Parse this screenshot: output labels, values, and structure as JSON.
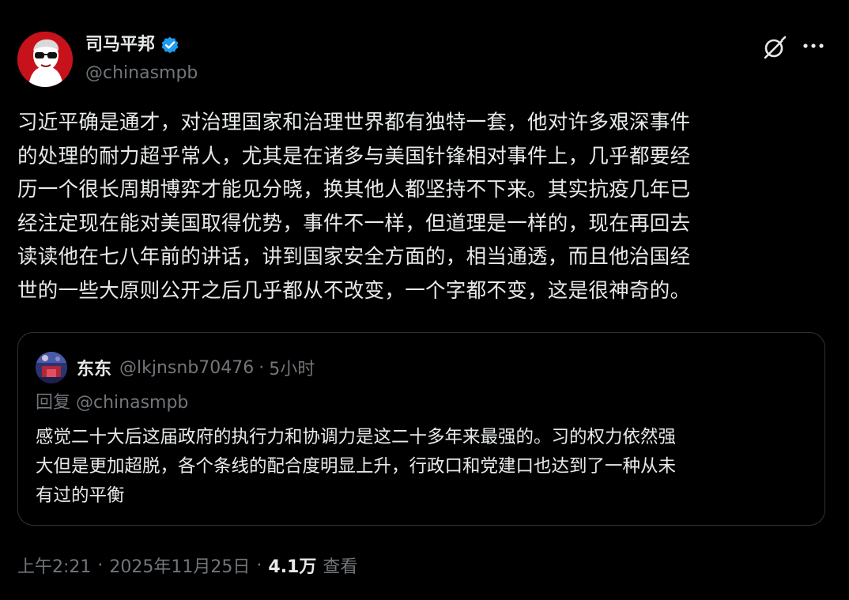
{
  "tweet": {
    "author": {
      "display_name": "司马平邦",
      "handle": "@chinasmpb",
      "verified": true,
      "badge_color": "#1d9bf0"
    },
    "text_lines": [
      "习近平确是通才，对治理国家和治理世界都有独特一套，他对许多艰深事件",
      "的处理的耐力超乎常人，尤其是在诸多与美国针锋相对事件上，几乎都要经",
      "历一个很长周期博弈才能见分晓，换其他人都坚持不下来。其实抗疫几年已",
      "经注定现在能对美国取得优势，事件不一样，但道理是一样的，现在再回去",
      "读读他在七八年前的讲话，讲到国家安全方面的，相当通透，而且他治国经",
      "世的一些大原则公开之后几乎都从不改变，一个字都不变，这是很神奇的。"
    ],
    "quote": {
      "display_name": "东东",
      "handle": "@lkjnsnb70476",
      "separator": "·",
      "time": "5小时",
      "reply_to": "回复 @chinasmpb",
      "text_lines": [
        "感觉二十大后这届政府的执行力和协调力是这二十多年来最强的。习的权力依然强",
        "大但是更加超脱，各个条线的配合度明显上升，行政口和党建口也达到了一种从未",
        "有过的平衡"
      ]
    },
    "meta": {
      "time": "上午2:21",
      "separator": "·",
      "date": "2025年11月25日",
      "views_count": "4.1万",
      "views_label": "查看"
    }
  },
  "icons": {
    "grok": "grok-icon",
    "more": "more-horizontal-icon",
    "verified": "verified-badge-icon"
  },
  "colors": {
    "background": "#000000",
    "text_primary": "#e7e9ea",
    "text_secondary": "#71767b",
    "border": "#2f3336",
    "accent": "#1d9bf0"
  }
}
